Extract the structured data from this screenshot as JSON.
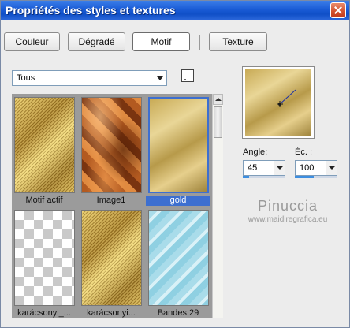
{
  "window": {
    "title": "Propriétés des styles et textures"
  },
  "tabs": [
    {
      "label": "Couleur"
    },
    {
      "label": "Dégradé"
    },
    {
      "label": "Motif",
      "active": true
    },
    {
      "label": "Texture"
    }
  ],
  "category": {
    "value": "Tous"
  },
  "patterns": [
    {
      "label": "Motif actif",
      "style": "gold-sparkle"
    },
    {
      "label": "Image1",
      "style": "copper"
    },
    {
      "label": "gold",
      "style": "gold-plain",
      "selected": true
    },
    {
      "label": "karácsonyi_...",
      "style": "checker"
    },
    {
      "label": "karácsonyi...",
      "style": "gold-sparkle"
    },
    {
      "label": "Bandes 29",
      "style": "blue-stripes"
    }
  ],
  "angle": {
    "label": "Angle:",
    "value": "45"
  },
  "scale": {
    "label": "Éc. :",
    "value": "100"
  },
  "watermark": {
    "name": "Pinuccia",
    "site": "www.maidiregrafica.eu"
  },
  "icons": {
    "close": "close-icon",
    "browse": "book-icon",
    "dropdown": "chevron-down-icon"
  },
  "colors": {
    "titlebar": "#1a5cd6",
    "selection": "#3d6fd0"
  }
}
